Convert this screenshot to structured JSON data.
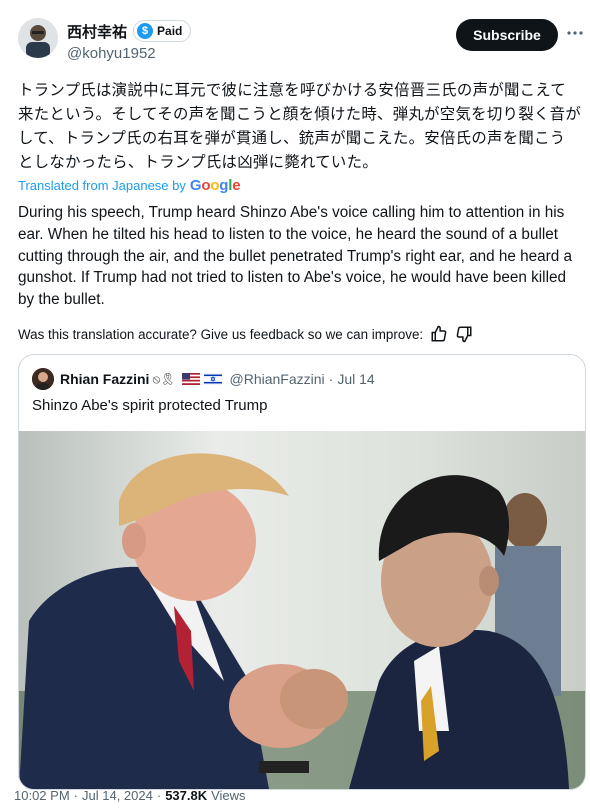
{
  "author": {
    "display_name": "西村幸祐",
    "badge_label": "Paid",
    "badge_icon": "dollar-icon",
    "handle": "@kohyu1952"
  },
  "header_actions": {
    "subscribe_label": "Subscribe",
    "more_icon": "more-icon"
  },
  "post": {
    "original_text": "トランプ氏は演説中に耳元で彼に注意を呼びかける安倍晋三氏の声が聞こえて来たという。そしてその声を聞こうと顔を傾けた時、弾丸が空気を切り裂く音がして、トランプ氏の右耳を弾が貫通し、銃声が聞こえた。安倍氏の声を聞こうとしなかったら、トランプ氏は凶弾に斃れていた。",
    "translated_label": "Translated from Japanese by",
    "google_logo": "Google",
    "translated_text": "During his speech, Trump heard Shinzo Abe's voice calling him to attention in his ear. When he tilted his head to listen to the voice, he heard the sound of a bullet cutting through the air, and the bullet penetrated Trump's right ear, and he heard a gunshot. If Trump had not tried to listen to Abe's voice, he would have been killed by the bullet.",
    "feedback_prompt": "Was this translation accurate? Give us feedback so we can improve:"
  },
  "quote": {
    "display_name": "Rhian Fazzini",
    "handle": "@RhianFazzini",
    "date": "Jul 14",
    "separator": "·",
    "text": "Shinzo Abe's spirit protected Trump"
  },
  "footer": {
    "time": "10:02 PM",
    "date": "Jul 14, 2024",
    "views_count": "537.8K",
    "views_label": "Views",
    "separator": "·"
  },
  "colors": {
    "accent": "#1d9bf0",
    "text": "#0f1419",
    "muted": "#536471",
    "border": "#cfd9de"
  }
}
